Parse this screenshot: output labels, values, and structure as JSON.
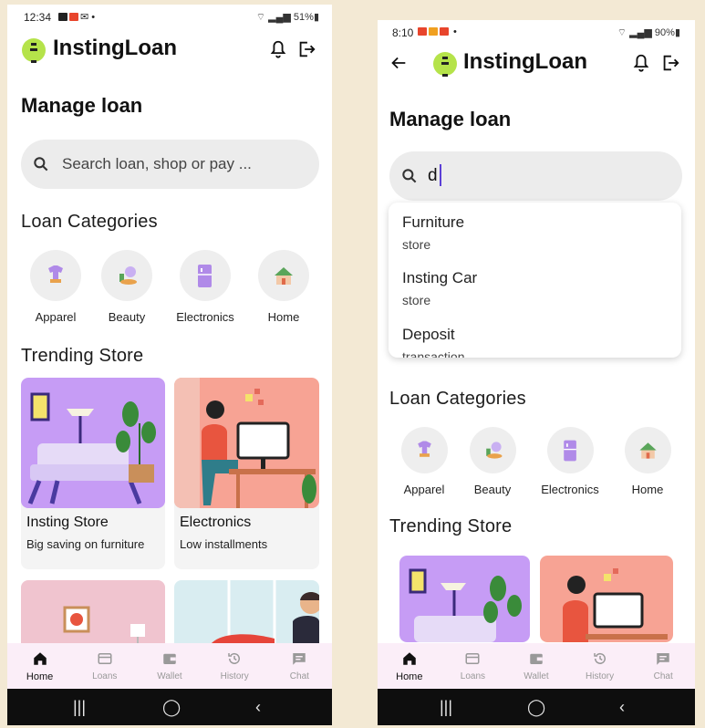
{
  "left": {
    "status": {
      "time": "12:34",
      "battery": "51%"
    },
    "app_title": "InstingLoan",
    "heading": "Manage loan",
    "search": {
      "placeholder": "Search loan,  shop or pay ..."
    },
    "categories_title": "Loan Categories",
    "categories": [
      "Apparel",
      "Beauty",
      "Electronics",
      "Home"
    ],
    "trending_title": "Trending Store",
    "stores": [
      {
        "title": "Insting Store",
        "subtitle": "Big saving on furniture"
      },
      {
        "title": "Electronics",
        "subtitle": "Low installments"
      }
    ],
    "nav": [
      "Home",
      "Loans",
      "Wallet",
      "History",
      "Chat"
    ]
  },
  "right": {
    "status": {
      "time": "8:10",
      "battery": "90%"
    },
    "app_title": "InstingLoan",
    "heading": "Manage loan",
    "search": {
      "value": "d"
    },
    "suggestions": [
      {
        "title": "Furniture",
        "type": "store"
      },
      {
        "title": "Insting Car",
        "type": "store"
      },
      {
        "title": "Deposit",
        "type": "transaction"
      }
    ],
    "categories_title": "Loan Categories",
    "categories": [
      "Apparel",
      "Beauty",
      "Electronics",
      "Home"
    ],
    "trending_title": "Trending Store",
    "nav": [
      "Home",
      "Loans",
      "Wallet",
      "History",
      "Chat"
    ]
  },
  "colors": {
    "logo": "#b5e34a",
    "card_purple": "#c69cf5",
    "card_salmon": "#f7a394",
    "nav_background": "#fbeef8",
    "search_background": "#ececec"
  }
}
